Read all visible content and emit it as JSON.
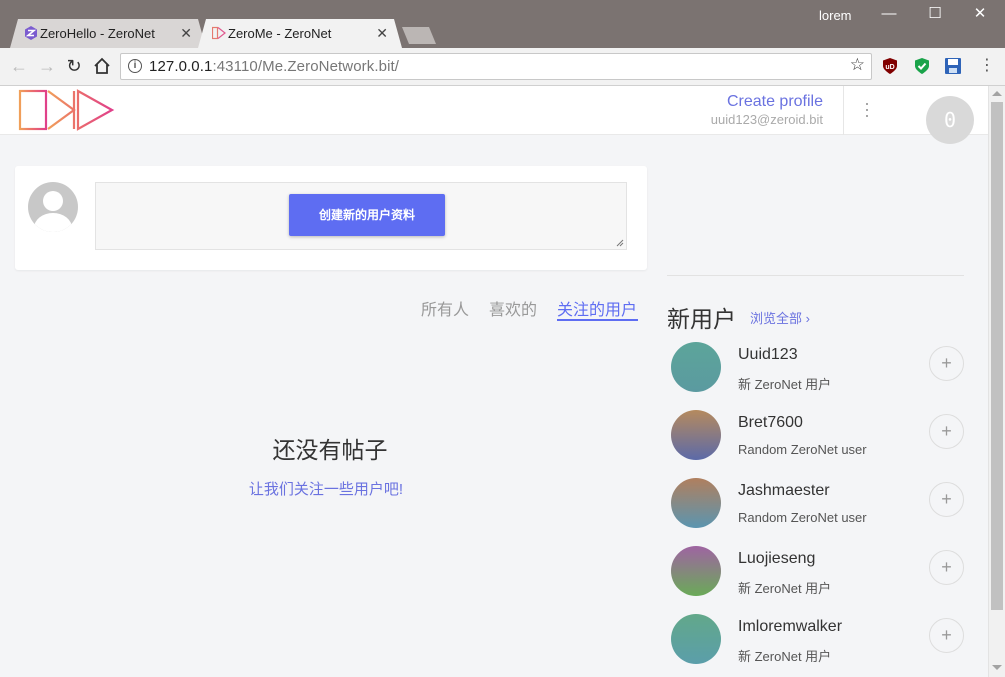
{
  "browser": {
    "tabs": [
      {
        "title": "ZeroHello - ZeroNet",
        "active": false
      },
      {
        "title": "ZeroMe - ZeroNet",
        "active": true
      }
    ],
    "window_user": "lorem",
    "url_host": "127.0.0.1",
    "url_rest": ":43110/Me.ZeroNetwork.bit/",
    "extensions": [
      {
        "name": "ublock-icon",
        "label": "uD",
        "color": "#800000"
      },
      {
        "name": "shield-icon",
        "label": "✓",
        "color": "#1aa34a"
      },
      {
        "name": "save-icon",
        "label": "",
        "color": "#2f64b8"
      }
    ]
  },
  "header": {
    "create_profile": "Create profile",
    "user_address": "uuid123@zeroid.bit",
    "balance": "0"
  },
  "composer": {
    "create_button": "创建新的用户资料"
  },
  "feed_tabs": [
    {
      "label": "所有人",
      "active": false
    },
    {
      "label": "喜欢的",
      "active": false
    },
    {
      "label": "关注的用户",
      "active": true
    }
  ],
  "empty_state": {
    "title": "还没有帖子",
    "link": "让我们关注一些用户吧!"
  },
  "sidebar": {
    "title": "新用户",
    "view_all": "浏览全部 ›",
    "users": [
      {
        "name": "Uuid123",
        "desc": "新 ZeroNet 用户",
        "colors": [
          "#5ca59a",
          "#5b9aa0"
        ]
      },
      {
        "name": "Bret7600",
        "desc": "Random ZeroNet user",
        "colors": [
          "#b58a5e",
          "#5c6aa8"
        ]
      },
      {
        "name": "Jashmaester",
        "desc": "Random ZeroNet user",
        "colors": [
          "#b07f5e",
          "#5b95b0"
        ]
      },
      {
        "name": "Luojieseng",
        "desc": "新 ZeroNet 用户",
        "colors": [
          "#9f64a2",
          "#6aaa58"
        ]
      },
      {
        "name": "Imloremwalker",
        "desc": "新 ZeroNet 用户",
        "colors": [
          "#62a88a",
          "#5b9eaa"
        ]
      }
    ]
  }
}
